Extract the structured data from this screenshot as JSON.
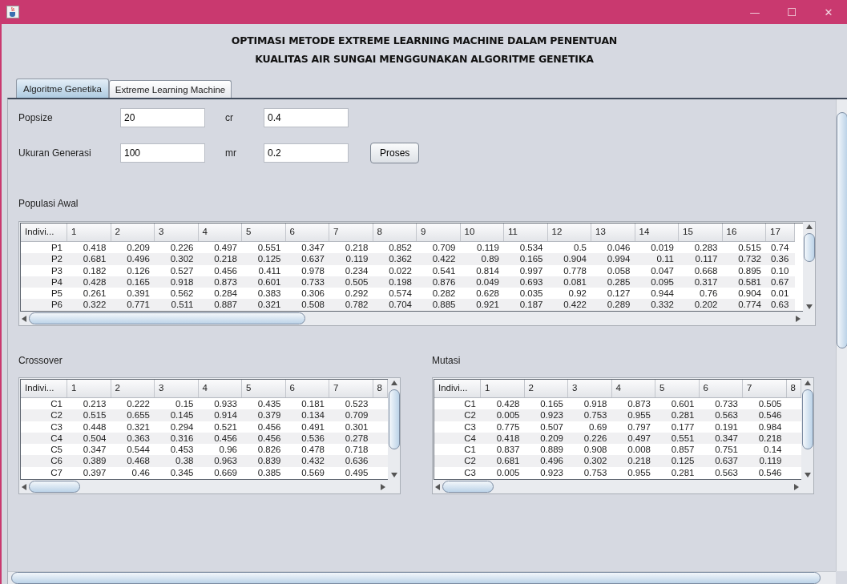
{
  "window": {
    "title_buttons": [
      "—",
      "☐",
      "✕"
    ]
  },
  "heading": [
    "OPTIMASI METODE EXTREME LEARNING MACHINE DALAM PENENTUAN",
    "KUALITAS AIR SUNGAI MENGGUNAKAN ALGORITME GENETIKA"
  ],
  "tabs": [
    {
      "label": "Algoritme Genetika",
      "selected": true
    },
    {
      "label": "Extreme Learning Machine",
      "selected": false
    }
  ],
  "form": {
    "rows": [
      {
        "fields": [
          {
            "label": "Popsize",
            "value": "20"
          },
          {
            "label": "cr",
            "value": "0.4"
          }
        ]
      },
      {
        "fields": [
          {
            "label": "Ukuran Generasi",
            "value": "100"
          },
          {
            "label": "mr",
            "value": "0.2"
          }
        ],
        "button": "Proses"
      }
    ]
  },
  "populasi": {
    "title": "Populasi Awal",
    "columns": [
      "Indivi...",
      "1",
      "2",
      "3",
      "4",
      "5",
      "6",
      "7",
      "8",
      "9",
      "10",
      "11",
      "12",
      "13",
      "14",
      "15",
      "16",
      "17"
    ],
    "rows": [
      [
        "P1",
        "0.418",
        "0.209",
        "0.226",
        "0.497",
        "0.551",
        "0.347",
        "0.218",
        "0.852",
        "0.709",
        "0.119",
        "0.534",
        "0.5",
        "0.046",
        "0.019",
        "0.283",
        "0.515",
        "0.74"
      ],
      [
        "P2",
        "0.681",
        "0.496",
        "0.302",
        "0.218",
        "0.125",
        "0.637",
        "0.119",
        "0.362",
        "0.422",
        "0.89",
        "0.165",
        "0.904",
        "0.994",
        "0.11",
        "0.117",
        "0.732",
        "0.36"
      ],
      [
        "P3",
        "0.182",
        "0.126",
        "0.527",
        "0.456",
        "0.411",
        "0.978",
        "0.234",
        "0.022",
        "0.541",
        "0.814",
        "0.997",
        "0.778",
        "0.058",
        "0.047",
        "0.668",
        "0.895",
        "0.10"
      ],
      [
        "P4",
        "0.428",
        "0.165",
        "0.918",
        "0.873",
        "0.601",
        "0.733",
        "0.505",
        "0.198",
        "0.876",
        "0.049",
        "0.693",
        "0.081",
        "0.285",
        "0.095",
        "0.317",
        "0.581",
        "0.67"
      ],
      [
        "P5",
        "0.261",
        "0.391",
        "0.562",
        "0.284",
        "0.383",
        "0.306",
        "0.292",
        "0.574",
        "0.282",
        "0.628",
        "0.035",
        "0.92",
        "0.127",
        "0.944",
        "0.76",
        "0.904",
        "0.01"
      ],
      [
        "P6",
        "0.322",
        "0.771",
        "0.511",
        "0.887",
        "0.321",
        "0.508",
        "0.782",
        "0.704",
        "0.885",
        "0.921",
        "0.187",
        "0.422",
        "0.289",
        "0.332",
        "0.202",
        "0.774",
        "0.63"
      ]
    ]
  },
  "crossover": {
    "title": "Crossover",
    "columns": [
      "Indivi...",
      "1",
      "2",
      "3",
      "4",
      "5",
      "6",
      "7",
      "8"
    ],
    "rows": [
      [
        "C1",
        "0.213",
        "0.222",
        "0.15",
        "0.933",
        "0.435",
        "0.181",
        "0.523"
      ],
      [
        "C2",
        "0.515",
        "0.655",
        "0.145",
        "0.914",
        "0.379",
        "0.134",
        "0.709"
      ],
      [
        "C3",
        "0.448",
        "0.321",
        "0.294",
        "0.521",
        "0.456",
        "0.491",
        "0.301"
      ],
      [
        "C4",
        "0.504",
        "0.363",
        "0.316",
        "0.456",
        "0.456",
        "0.536",
        "0.278"
      ],
      [
        "C5",
        "0.347",
        "0.544",
        "0.453",
        "0.96",
        "0.826",
        "0.478",
        "0.718"
      ],
      [
        "C6",
        "0.389",
        "0.468",
        "0.38",
        "0.963",
        "0.839",
        "0.432",
        "0.636"
      ],
      [
        "C7",
        "0.397",
        "0.46",
        "0.345",
        "0.669",
        "0.385",
        "0.569",
        "0.495"
      ]
    ]
  },
  "mutasi": {
    "title": "Mutasi",
    "columns": [
      "Indivi...",
      "1",
      "2",
      "3",
      "4",
      "5",
      "6",
      "7",
      "8"
    ],
    "rows": [
      [
        "C1",
        "0.428",
        "0.165",
        "0.918",
        "0.873",
        "0.601",
        "0.733",
        "0.505"
      ],
      [
        "C2",
        "0.005",
        "0.923",
        "0.753",
        "0.955",
        "0.281",
        "0.563",
        "0.546"
      ],
      [
        "C3",
        "0.775",
        "0.507",
        "0.69",
        "0.797",
        "0.177",
        "0.191",
        "0.984"
      ],
      [
        "C4",
        "0.418",
        "0.209",
        "0.226",
        "0.497",
        "0.551",
        "0.347",
        "0.218"
      ],
      [
        "C1",
        "0.837",
        "0.889",
        "0.908",
        "0.008",
        "0.857",
        "0.751",
        "0.14"
      ],
      [
        "C2",
        "0.681",
        "0.496",
        "0.302",
        "0.218",
        "0.125",
        "0.637",
        "0.119"
      ],
      [
        "C3",
        "0.005",
        "0.923",
        "0.753",
        "0.955",
        "0.281",
        "0.563",
        "0.546"
      ]
    ]
  }
}
